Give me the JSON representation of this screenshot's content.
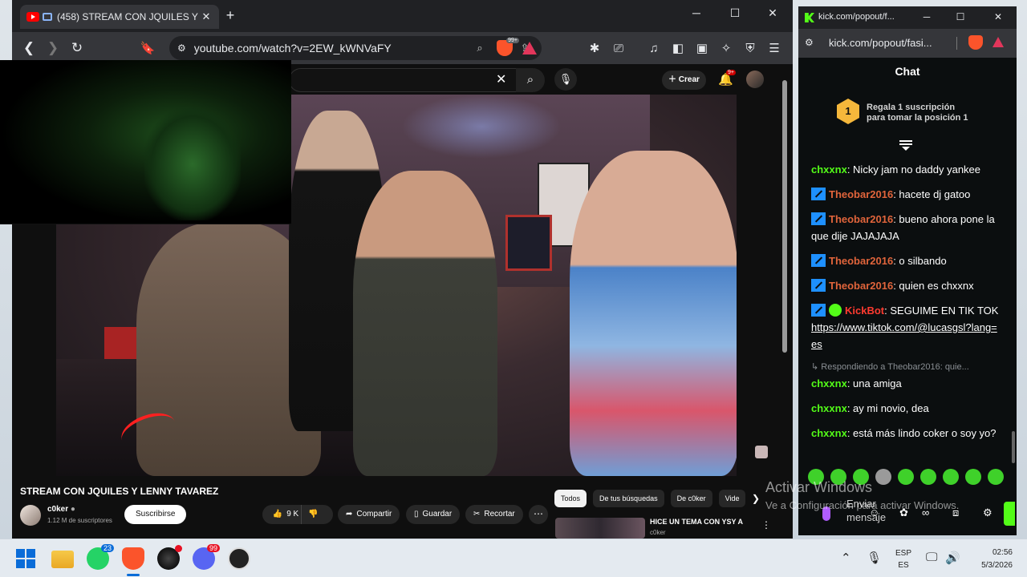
{
  "youtube_window": {
    "tab_title": "(458) STREAM CON JQUILES Y",
    "url": "youtube.com/watch?v=2EW_kWNVaFY",
    "brave_badge": "99+",
    "create_label": "Crear",
    "notifications_badge": "9+",
    "video_title": "STREAM CON JQUILES Y LENNY TAVAREZ",
    "channel_name": "c0ker",
    "channel_subs": "1.12 M de suscriptores",
    "subscribe_label": "Suscribirse",
    "likes": "9 K",
    "share_label": "Compartir",
    "save_label": "Guardar",
    "clip_label": "Recortar",
    "chips": [
      "Todos",
      "De tus búsquedas",
      "De c0ker",
      "Vide"
    ],
    "related": {
      "title": "HICE UN TEMA CON YSY A",
      "channel": "c0ker"
    }
  },
  "kick_window": {
    "tab_title": "kick.com/popout/f...",
    "url": "kick.com/popout/fasi...",
    "chat_header": "Chat",
    "gift_number": "1",
    "gift_line1": "Regala 1 suscripción",
    "gift_line2": "para tomar la posición 1",
    "messages": [
      {
        "user": "chxxnx",
        "text": ": Nicky jam no daddy yankee"
      },
      {
        "user": "Theobar2016",
        "text": ": hacete dj gatoo"
      },
      {
        "user": "Theobar2016",
        "text": ": bueno ahora pone la que dije JAJAJAJA"
      },
      {
        "user": "Theobar2016",
        "text": ": o silbando"
      },
      {
        "user": "Theobar2016",
        "text": ": quien es chxxnx"
      },
      {
        "user": "KickBot",
        "text": ": SEGUIME EN TIK TOK ",
        "link": "https://www.tiktok.com/@lucasgsl?lang=es"
      },
      {
        "reply_to": "Respondiendo a Theobar2016: quie...",
        "user": "chxxnx",
        "text": ": una amiga"
      },
      {
        "user": "chxxnx",
        "text": ": ay mi novio, dea"
      },
      {
        "user": "chxxnx",
        "text": ": está más lindo coker o soy yo?"
      }
    ],
    "send_label": "Enviar mensaje"
  },
  "windows_activation": {
    "line1": "Activar Windows",
    "line2": "Ve a Configuración para activar Windows."
  },
  "taskbar": {
    "whatsapp_badge": "23",
    "discord_badge": "99",
    "lang_line1": "ESP",
    "lang_line2": "ES",
    "time": "02:56",
    "date": "5/3/2026"
  },
  "colors": {
    "kick_green": "#53fc18",
    "yt_red": "#ff0000",
    "brave_orange": "#fb542b"
  }
}
